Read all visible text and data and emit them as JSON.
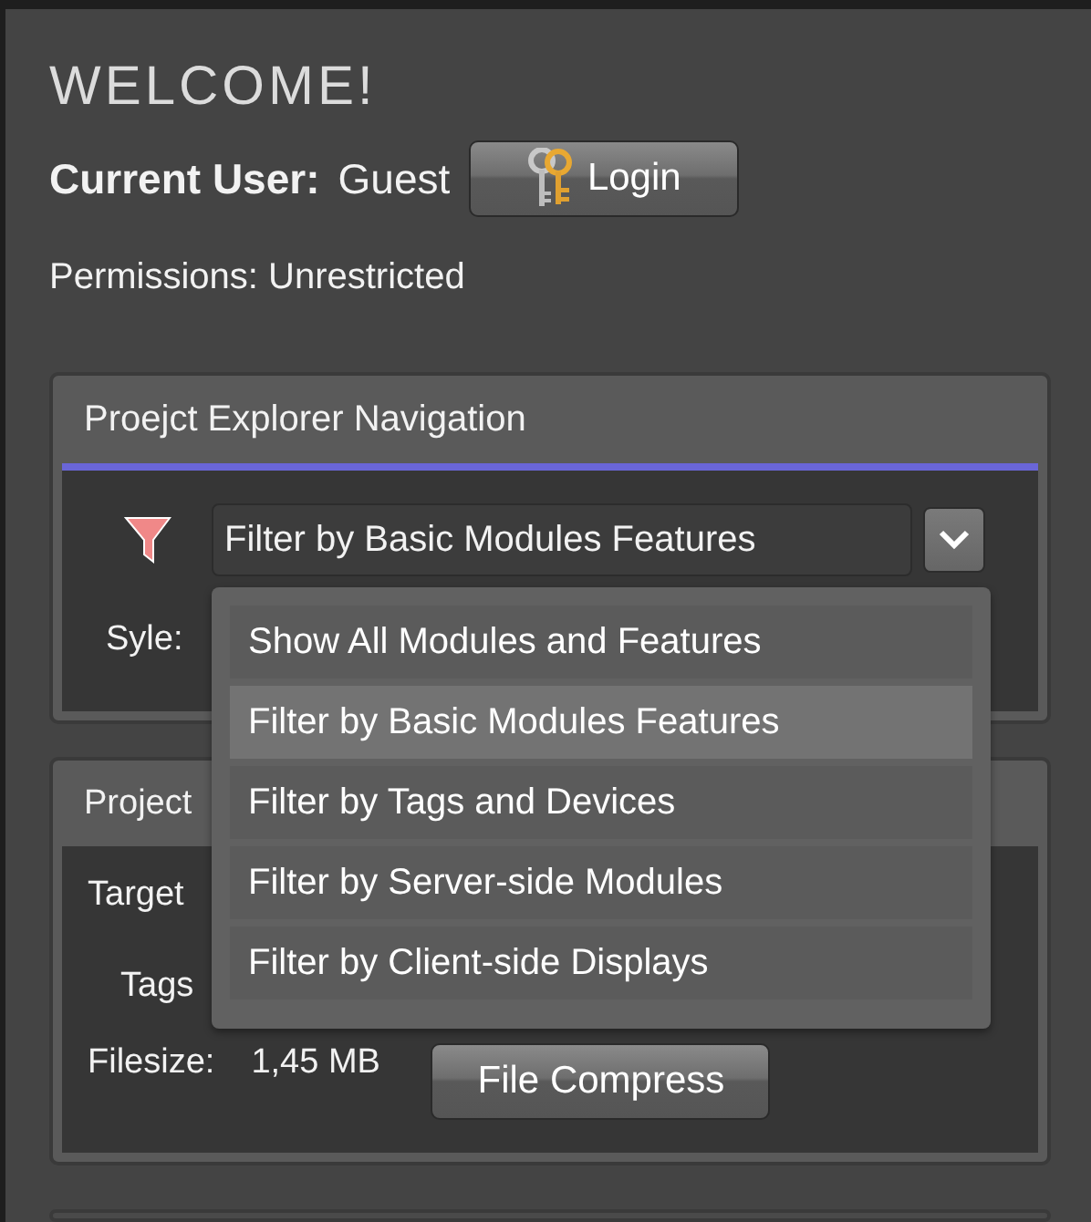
{
  "title": "WELCOME!",
  "user": {
    "label": "Current User:",
    "name": "Guest",
    "login_button": "Login"
  },
  "permissions": "Permissions: Unrestricted",
  "navigation_panel": {
    "title": "Proejct Explorer Navigation",
    "filter": {
      "value": "Filter by Basic Modules Features",
      "expanded": true,
      "options": [
        {
          "label": "Show All Modules and Features",
          "selected": false
        },
        {
          "label": "Filter by Basic Modules Features",
          "selected": true
        },
        {
          "label": "Filter by Tags and Devices",
          "selected": false
        },
        {
          "label": "Filter by Server-side Modules",
          "selected": false
        },
        {
          "label": "Filter by Client-side Displays",
          "selected": false
        }
      ]
    },
    "style_label": "Syle:"
  },
  "project_panel": {
    "title": "Project",
    "target_label": "Target",
    "tags_label": "Tags",
    "filesize_label": "Filesize:",
    "filesize": "1,45 MB",
    "compress_button": "File Compress"
  }
}
